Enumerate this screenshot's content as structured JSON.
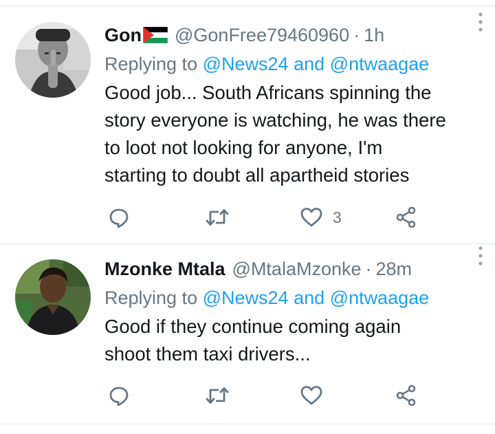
{
  "tweets": [
    {
      "display_name": "Gon",
      "handle": "@GonFree79460960",
      "separator": "·",
      "time": "1h",
      "replying_prefix": "Replying to",
      "mention_1": "@News24",
      "conjunction": "and",
      "mention_2": "@ntwaagae",
      "text": "Good job... South Africans spinning the\nstory everyone is watching, he was there\nto loot not looking for anyone, I'm\nstarting to doubt all apartheid stories",
      "like_count": "3",
      "has_flag": true
    },
    {
      "display_name": "Mzonke Mtala",
      "handle": "@MtalaMzonke",
      "separator": "·",
      "time": "28m",
      "replying_prefix": "Replying to",
      "mention_1": "@News24",
      "conjunction": "and",
      "mention_2": "@ntwaagae",
      "text": "Good if they continue coming again\nshoot them taxi drivers...",
      "like_count": "",
      "has_flag": false
    }
  ],
  "colors": {
    "text_primary": "#14171a",
    "text_secondary": "#657786",
    "mention_blue": "#1da1f2",
    "divider": "#e1e8ed"
  },
  "icons": {
    "reply": "reply-icon",
    "retweet": "retweet-icon",
    "like": "heart-icon",
    "share": "share-icon",
    "more": "more-vertical-icon",
    "flag": "palestine-flag-icon"
  }
}
